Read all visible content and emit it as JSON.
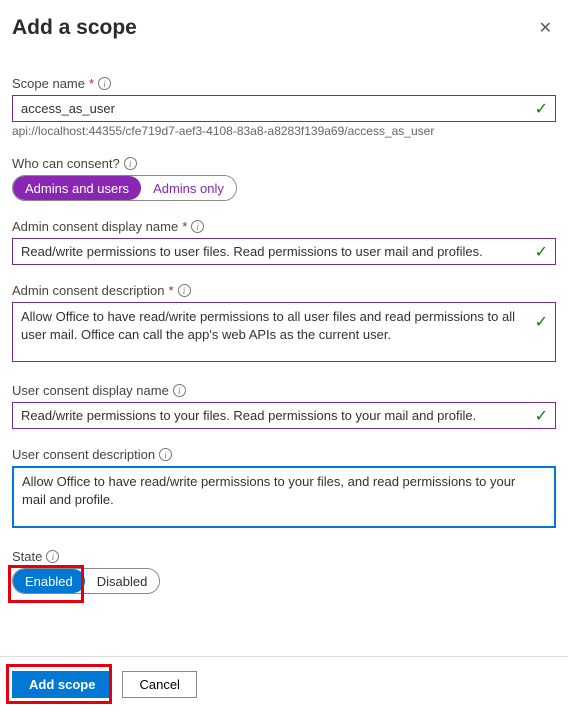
{
  "header": {
    "title": "Add a scope"
  },
  "scopeName": {
    "label": "Scope name",
    "value": "access_as_user",
    "uri": "api://localhost:44355/cfe719d7-aef3-4108-83a8-a8283f139a69/access_as_user"
  },
  "whoCanConsent": {
    "label": "Who can consent?",
    "options": {
      "a": "Admins and users",
      "b": "Admins only"
    }
  },
  "adminDisplayName": {
    "label": "Admin consent display name",
    "value": "Read/write permissions to user files. Read permissions to user mail and profiles."
  },
  "adminDescription": {
    "label": "Admin consent description",
    "value": "Allow Office to have read/write permissions to all user files and read permissions to all user mail. Office can call the app's web APIs as the current user."
  },
  "userDisplayName": {
    "label": "User consent display name",
    "value": "Read/write permissions to your files. Read permissions to your mail and profile."
  },
  "userDescription": {
    "label": "User consent description",
    "value": "Allow Office to have read/write permissions to your files, and read permissions to your mail and profile."
  },
  "state": {
    "label": "State",
    "options": {
      "a": "Enabled",
      "b": "Disabled"
    }
  },
  "footer": {
    "add": "Add scope",
    "cancel": "Cancel"
  }
}
